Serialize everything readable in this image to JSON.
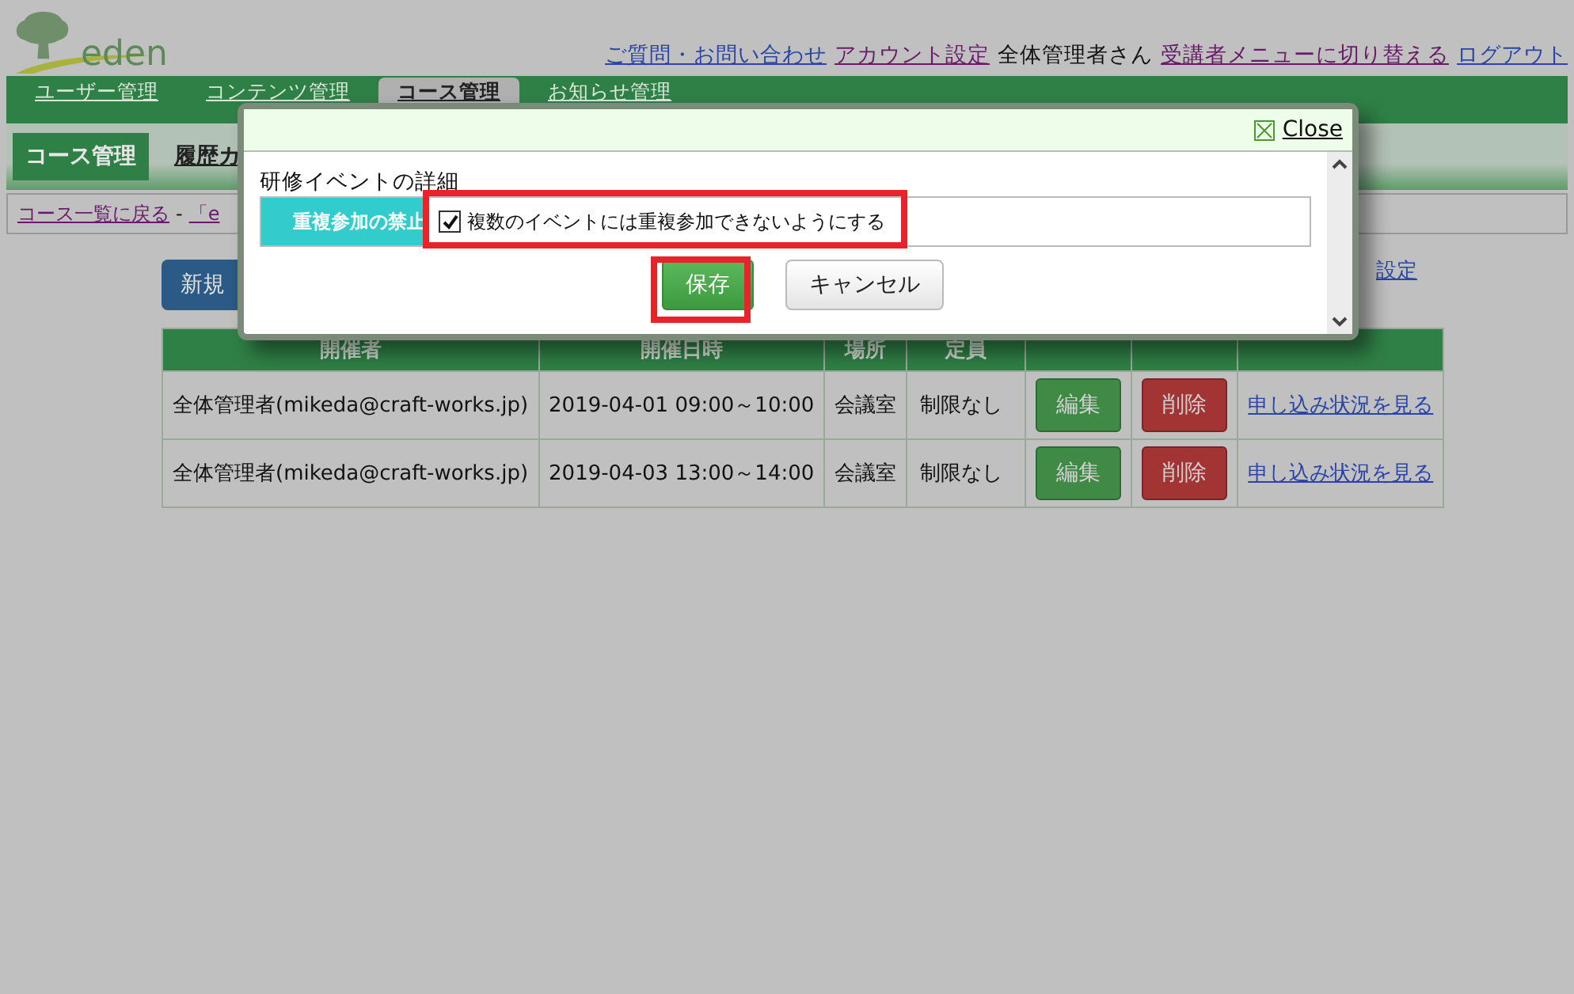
{
  "header": {
    "logo": "eden",
    "links": [
      {
        "text": "ご質問・お問い合わせ",
        "kind": "link"
      },
      {
        "text": "アカウント設定",
        "kind": "visited"
      },
      {
        "text": "全体管理者さん",
        "kind": "text"
      },
      {
        "text": "受講者メニューに切り替える",
        "kind": "visited"
      },
      {
        "text": "ログアウト",
        "kind": "link"
      }
    ]
  },
  "nav": {
    "tabs": [
      {
        "label": "ユーザー管理",
        "selected": false
      },
      {
        "label": "コンテンツ管理",
        "selected": false
      },
      {
        "label": "コース管理",
        "selected": true
      },
      {
        "label": "お知らせ管理",
        "selected": false
      }
    ]
  },
  "subnav": {
    "tabs": [
      {
        "label": "コース管理",
        "selected": true
      },
      {
        "label": "履歴カ",
        "selected": false
      }
    ]
  },
  "breadcrumb": {
    "back_link": "コース一覧に戻る",
    "separator": "-",
    "current": "「e"
  },
  "new_button": "新規",
  "settings_link": "設定",
  "table": {
    "columns": [
      "開催者",
      "開催日時",
      "場所",
      "定員"
    ],
    "rows": [
      {
        "organizer": "全体管理者(mikeda@craft-works.jp)",
        "datetime": "2019-04-01 09:00～10:00",
        "place": "会議室",
        "capacity": "制限なし",
        "edit": "編集",
        "delete": "削除",
        "status_link": "申し込み状況を見る"
      },
      {
        "organizer": "全体管理者(mikeda@craft-works.jp)",
        "datetime": "2019-04-03 13:00～14:00",
        "place": "会議室",
        "capacity": "制限なし",
        "edit": "編集",
        "delete": "削除",
        "status_link": "申し込み状況を見る"
      }
    ]
  },
  "modal": {
    "close": "Close",
    "section_title": "研修イベントの詳細",
    "field_label": "重複参加の禁止",
    "checkbox": {
      "label": "複数のイベントには重複参加できないようにする",
      "checked": true
    },
    "save": "保存",
    "cancel": "キャンセル"
  }
}
